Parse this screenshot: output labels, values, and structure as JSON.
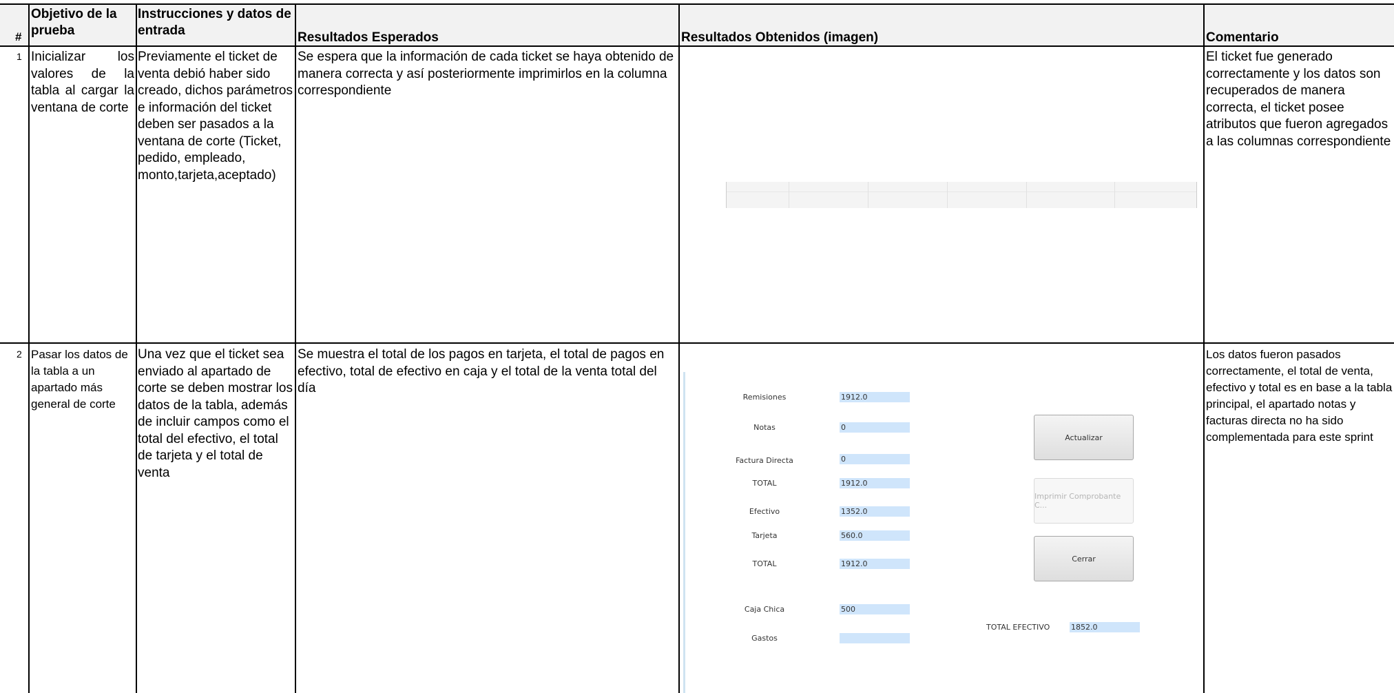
{
  "table": {
    "headers": {
      "num": "#",
      "objetivo": "Objetivo de la prueba",
      "instrucciones": "Instrucciones y datos de entrada",
      "esperados": "Resultados Esperados",
      "obtenidos": "Resultados Obtenidos (imagen)",
      "comentario": "Comentario"
    },
    "rows": [
      {
        "num": "1",
        "objetivo": "Inicializar los valores de la tabla al cargar la ventana de corte",
        "instrucciones": "Previamente el ticket de venta debió haber sido creado, dichos parámetros e información del ticket deben ser pasados a la ventana de corte (Ticket, pedido, empleado, monto,tarjeta,aceptado)",
        "esperados": "Se espera que la información de cada ticket se haya obtenido de manera correcta y así posteriormente imprimirlos en la columna correspondiente",
        "comentario": "El ticket fue generado correctamente y los datos son recuperados de manera correcta, el ticket posee atributos que fueron agregados a las columnas correspondiente"
      },
      {
        "num": "2",
        "objetivo": "Pasar los datos de la tabla a un apartado más general de corte",
        "instrucciones": "Una vez que el ticket sea enviado al apartado de corte se deben mostrar los datos de la tabla, además de incluir campos como el total del efectivo, el total de tarjeta y el total de venta",
        "esperados": " Se muestra el total de los pagos en tarjeta, el total de pagos en efectivo, total de efectivo en caja y el total de la venta total del día",
        "comentario": " Los datos fueron pasados correctamente, el total de venta, efectivo y total es en base a la tabla principal, el apartado notas y facturas directa no ha sido complementada para este sprint"
      }
    ]
  },
  "corte_window": {
    "fields": [
      {
        "label": "Remisiones",
        "value": "1912.0"
      },
      {
        "label": "Notas",
        "value": "0"
      },
      {
        "label": "Factura Directa",
        "value": "0"
      },
      {
        "label": "TOTAL",
        "value": "1912.0"
      },
      {
        "label": "Efectivo",
        "value": "1352.0"
      },
      {
        "label": "Tarjeta",
        "value": "560.0"
      },
      {
        "label": "TOTAL",
        "value": "1912.0"
      },
      {
        "label": "Caja Chica",
        "value": "500"
      },
      {
        "label": "Gastos",
        "value": ""
      }
    ],
    "total_efectivo": {
      "label": "TOTAL EFECTIVO",
      "value": "1852.0"
    },
    "buttons": {
      "actualizar": "Actualizar",
      "imprimir": "Imprimir Comprobante C...",
      "cerrar": "Cerrar"
    }
  }
}
